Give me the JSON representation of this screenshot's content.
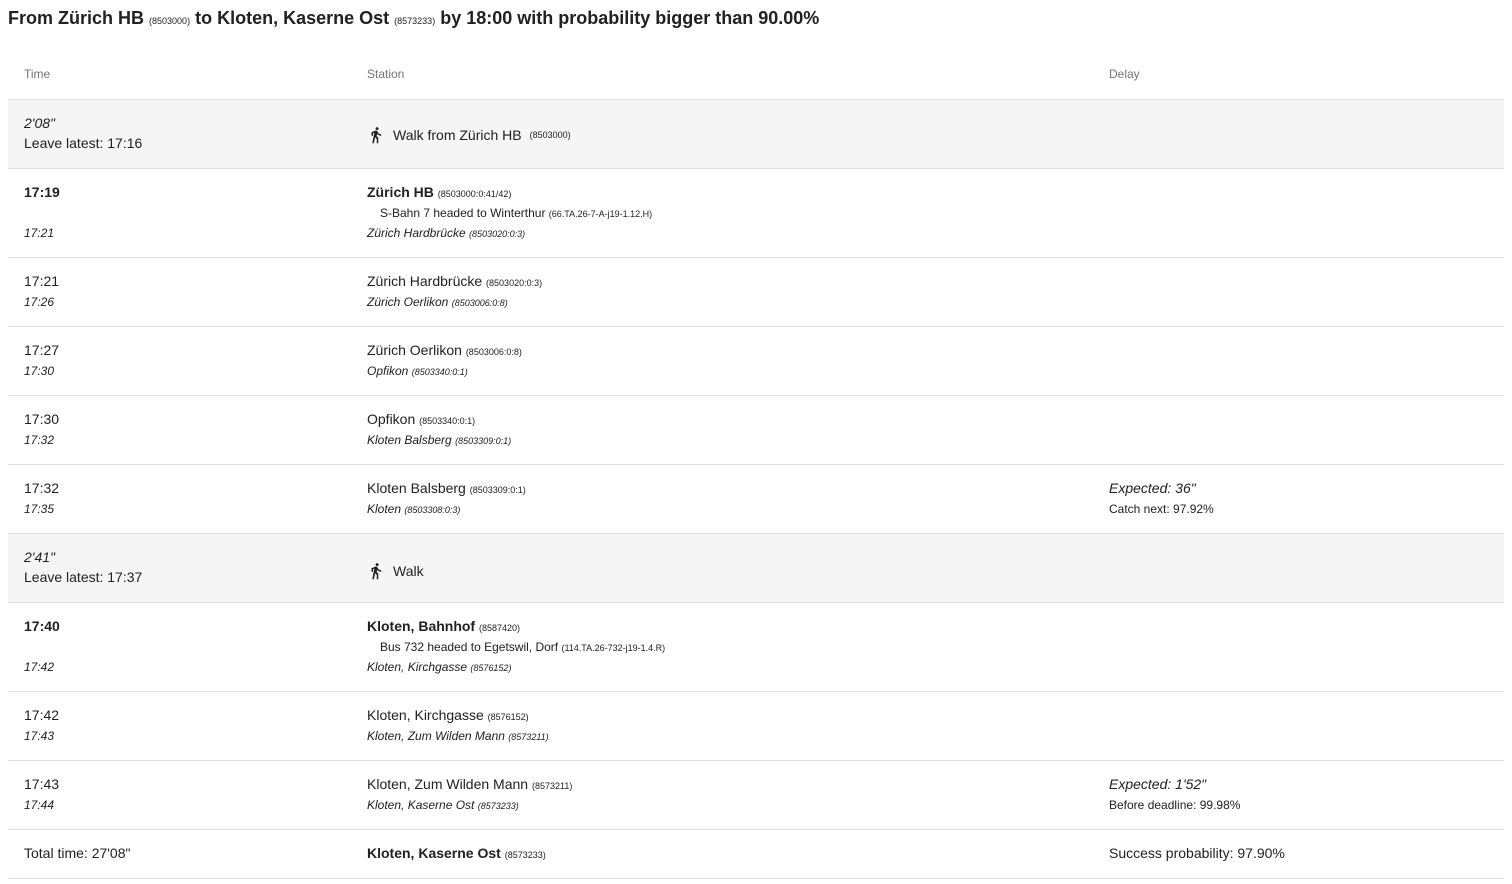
{
  "title": {
    "prefix": "From Zürich HB",
    "from_id": "(8503000)",
    "to_text": "to Kloten, Kaserne Ost",
    "to_id": "(8573233)",
    "suffix": "by 18:00 with probability bigger than 90.00%"
  },
  "headers": {
    "time": "Time",
    "station": "Station",
    "delay": "Delay"
  },
  "walk1": {
    "duration": "2'08\"",
    "leave": "Leave latest: 17:16",
    "label": "Walk from Zürich HB",
    "id": "(8503000)"
  },
  "legs": [
    {
      "dep_time": "17:19",
      "arr_time": "17:21",
      "station": "Zürich HB",
      "station_id": "(8503000:0:41/42)",
      "line": "S-Bahn 7 headed to Winterthur",
      "line_id": "(66.TA.26-7-A-j19-1.12.H)",
      "next": "Zürich Hardbrücke",
      "next_id": "(8503020:0:3)"
    },
    {
      "dep_time": "17:21",
      "arr_time": "17:26",
      "station": "Zürich Hardbrücke",
      "station_id": "(8503020:0:3)",
      "next": "Zürich Oerlikon",
      "next_id": "(8503006:0:8)"
    },
    {
      "dep_time": "17:27",
      "arr_time": "17:30",
      "station": "Zürich Oerlikon",
      "station_id": "(8503006:0:8)",
      "next": "Opfikon",
      "next_id": "(8503340:0:1)"
    },
    {
      "dep_time": "17:30",
      "arr_time": "17:32",
      "station": "Opfikon",
      "station_id": "(8503340:0:1)",
      "next": "Kloten Balsberg",
      "next_id": "(8503309:0:1)"
    },
    {
      "dep_time": "17:32",
      "arr_time": "17:35",
      "station": "Kloten Balsberg",
      "station_id": "(8503309:0:1)",
      "next": "Kloten",
      "next_id": "(8503308:0:3)",
      "delay_expected": "Expected: 36\"",
      "delay_info": "Catch next: 97.92%"
    }
  ],
  "walk2": {
    "duration": "2'41\"",
    "leave": "Leave latest: 17:37",
    "label": "Walk"
  },
  "legs2": [
    {
      "dep_time": "17:40",
      "arr_time": "17:42",
      "station": "Kloten, Bahnhof",
      "station_id": "(8587420)",
      "line": "Bus 732 headed to Egetswil, Dorf",
      "line_id": "(114.TA.26-732-j19-1.4.R)",
      "next": "Kloten, Kirchgasse",
      "next_id": "(8576152)"
    },
    {
      "dep_time": "17:42",
      "arr_time": "17:43",
      "station": "Kloten, Kirchgasse",
      "station_id": "(8576152)",
      "next": "Kloten, Zum Wilden Mann",
      "next_id": "(8573211)"
    },
    {
      "dep_time": "17:43",
      "arr_time": "17:44",
      "station": "Kloten, Zum Wilden Mann",
      "station_id": "(8573211)",
      "next": "Kloten, Kaserne Ost",
      "next_id": "(8573233)",
      "delay_expected": "Expected: 1'52\"",
      "delay_info": "Before deadline: 99.98%"
    }
  ],
  "total": {
    "time": "Total time: 27'08\"",
    "station": "Kloten, Kaserne Ost",
    "station_id": "(8573233)",
    "success": "Success probability: 97.90%"
  }
}
